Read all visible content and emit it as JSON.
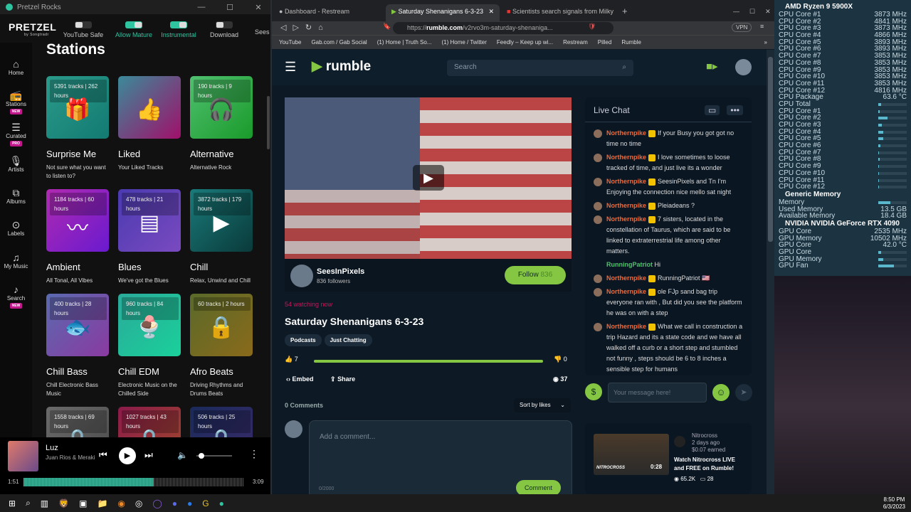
{
  "pretzel": {
    "window_title": "Pretzel Rocks",
    "logo": "PRETZEL",
    "logo_sub": "by Songtradr",
    "toggles": [
      {
        "label": "YouTube Safe",
        "on": false
      },
      {
        "label": "Allow Mature",
        "on": true
      },
      {
        "label": "Instrumental",
        "on": true
      },
      {
        "label": "Download",
        "on": false
      }
    ],
    "overflow_label": "Sees",
    "nav": [
      {
        "label": "Home"
      },
      {
        "label": "Stations",
        "badge": "NEW"
      },
      {
        "label": "Curated",
        "badge": "PRO"
      },
      {
        "label": "Artists"
      },
      {
        "label": "Albums"
      },
      {
        "label": "Labels"
      },
      {
        "label": "My Music"
      },
      {
        "label": "Search",
        "badge": "NEW"
      }
    ],
    "heading": "Stations",
    "stations": [
      {
        "count": "5391 tracks | 262 hours",
        "title": "Surprise Me",
        "desc": "Not sure what you want to listen to?",
        "icon": "gift"
      },
      {
        "count": "",
        "title": "Liked",
        "desc": "Your Liked Tracks",
        "icon": "thumbs-up"
      },
      {
        "count": "190 tracks | 9 hours",
        "title": "Alternative",
        "desc": "Alternative Rock",
        "icon": "headphones"
      },
      {
        "count": "1184 tracks | 60 hours",
        "title": "Ambient",
        "desc": "All Tonal, All Vibes",
        "icon": "waveform"
      },
      {
        "count": "478 tracks | 21 hours",
        "title": "Blues",
        "desc": "We've got the Blues",
        "icon": "harmonica"
      },
      {
        "count": "3872 tracks | 179 hours",
        "title": "Chill",
        "desc": "Relax, Unwind and Chill",
        "icon": "play"
      },
      {
        "count": "400 tracks | 28 hours",
        "title": "Chill Bass",
        "desc": "Chill Electronic Bass Music",
        "icon": "fish"
      },
      {
        "count": "960 tracks | 84 hours",
        "title": "Chill EDM",
        "desc": "Electronic Music on the Chilled Side",
        "icon": "ice-cream"
      },
      {
        "count": "60 tracks | 2 hours",
        "title": "Afro Beats",
        "desc": "Driving Rhythms and Drums Beats",
        "icon": "lock"
      },
      {
        "count": "1558 tracks | 69 hours",
        "title": "",
        "desc": "",
        "icon": "lock"
      },
      {
        "count": "1027 tracks | 43 hours",
        "title": "",
        "desc": "",
        "icon": "lock"
      },
      {
        "count": "506 tracks | 25 hours",
        "title": "",
        "desc": "",
        "icon": "lock"
      }
    ],
    "player": {
      "track": "Luz",
      "artist": "Juan Rios & Meraki",
      "elapsed": "1:51",
      "duration": "3:09",
      "progress": 0.59,
      "volume": 0.05
    }
  },
  "browser": {
    "tabs": [
      {
        "label": "Dashboard - Restream"
      },
      {
        "label": "Saturday Shenanigans 6-3-23"
      },
      {
        "label": "Scientists search signals from Milky W"
      }
    ],
    "url_prefix": "https://",
    "url_host": "rumble.com",
    "url_path": "/v2rvo3m-saturday-shenaniga...",
    "vpn": "VPN",
    "bookmarks": [
      "YouTube",
      "Gab.com / Gab Social",
      "(1) Home | Truth So...",
      "(1) Home / Twitter",
      "Feedly – Keep up wi...",
      "Restream",
      "Pilled",
      "Rumble"
    ],
    "overflow": "»"
  },
  "rumble": {
    "logo": "rumble",
    "search_placeholder": "Search",
    "channel": "SeesInPixels",
    "followers": "836 followers",
    "follow_label": "Follow",
    "follow_count": "836",
    "watching": "54 watching now",
    "title": "Saturday Shenanigans 6-3-23",
    "tags": [
      "Podcasts",
      "Just Chatting"
    ],
    "likes": "7",
    "dislikes": "0",
    "like_ratio": 1.0,
    "embed": "Embed",
    "share": "Share",
    "views": "37",
    "comments_count": "0 Comments",
    "sort": "Sort by likes",
    "comment_placeholder": "Add a comment...",
    "char_count": "0/2000",
    "comment_btn": "Comment",
    "chat": {
      "title": "Live Chat",
      "placeholder": "Your message here!",
      "messages": [
        {
          "user": "Northernpike",
          "text": "If your Busy you got got no time no time"
        },
        {
          "user": "Northernpike",
          "text": "I love sometimes to loose tracked of time, and just live its a wonder"
        },
        {
          "user": "Northernpike",
          "text": "SeesinPixels and Tn I'm Enjoying the connection nice mello sat night"
        },
        {
          "user": "Northernpike",
          "text": "Pleiadeans ?"
        },
        {
          "user": "Northernpike",
          "text": "7 sisters, located in the constellation of Taurus, which are said to be linked to extraterrestrial life among other matters."
        },
        {
          "user": "RunningPatriot",
          "text": "Hi",
          "green": true
        },
        {
          "user": "Northernpike",
          "text": "RunningPatriot 🇺🇸"
        },
        {
          "user": "Northernpike",
          "text": "ole FJp sand bag trip everyone ran with , But did you see the platform he was on with a step"
        },
        {
          "user": "Northernpike",
          "text": "What we call in construction a trip Hazard and its a state code and we have all walked off a curb or a short step and stumbled not funny , steps should be 6 to 8 inches a sensible step for humans"
        }
      ]
    },
    "promo": {
      "channel": "Nitrocross",
      "age": "2 days ago",
      "earned": "$0.07 earned",
      "title": "Watch Nitrocross LIVE and FREE on Rumble!",
      "duration": "0:28",
      "views": "65.2K",
      "comments": "28",
      "thumb_text": "NITROCROSS"
    }
  },
  "hwmonitor": {
    "cpu": "AMD Ryzen 9 5900X",
    "clocks": [
      [
        "CPU Core #1",
        "3873 MHz"
      ],
      [
        "CPU Core #2",
        "4841 MHz"
      ],
      [
        "CPU Core #3",
        "3873 MHz"
      ],
      [
        "CPU Core #4",
        "4866 MHz"
      ],
      [
        "CPU Core #5",
        "3893 MHz"
      ],
      [
        "CPU Core #6",
        "3893 MHz"
      ],
      [
        "CPU Core #7",
        "3853 MHz"
      ],
      [
        "CPU Core #8",
        "3853 MHz"
      ],
      [
        "CPU Core #9",
        "3853 MHz"
      ],
      [
        "CPU Core #10",
        "3853 MHz"
      ],
      [
        "CPU Core #11",
        "3853 MHz"
      ],
      [
        "CPU Core #12",
        "4816 MHz"
      ],
      [
        "CPU Package",
        "63.6 °C"
      ]
    ],
    "loads": [
      [
        "CPU Total",
        0.1
      ],
      [
        "CPU Core #1",
        0.05
      ],
      [
        "CPU Core #2",
        0.32
      ],
      [
        "CPU Core #3",
        0.12
      ],
      [
        "CPU Core #4",
        0.18
      ],
      [
        "CPU Core #5",
        0.17
      ],
      [
        "CPU Core #6",
        0.07
      ],
      [
        "CPU Core #7",
        0.02
      ],
      [
        "CPU Core #8",
        0.04
      ],
      [
        "CPU Core #9",
        0.02
      ],
      [
        "CPU Core #10",
        0.02
      ],
      [
        "CPU Core #11",
        0.02
      ],
      [
        "CPU Core #12",
        0.02
      ]
    ],
    "mem_title": "Generic Memory",
    "mem_label": "Memory",
    "mem_load": 0.42,
    "mem": [
      [
        "Used Memory",
        "13.5 GB"
      ],
      [
        "Available Memory",
        "18.4 GB"
      ]
    ],
    "gpu": "NVIDIA NVIDIA GeForce RTX 4090",
    "gpu_vals": [
      [
        "GPU Core",
        "2535 MHz"
      ],
      [
        "GPU Memory",
        "10502 MHz"
      ],
      [
        "GPU Core",
        "42.0 °C"
      ]
    ],
    "gpu_loads": [
      [
        "GPU Core",
        0.1
      ],
      [
        "GPU Memory",
        0.17
      ],
      [
        "GPU Fan",
        0.56
      ]
    ]
  },
  "taskbar": {
    "time": "8:50 PM",
    "date": "6/3/2023"
  }
}
